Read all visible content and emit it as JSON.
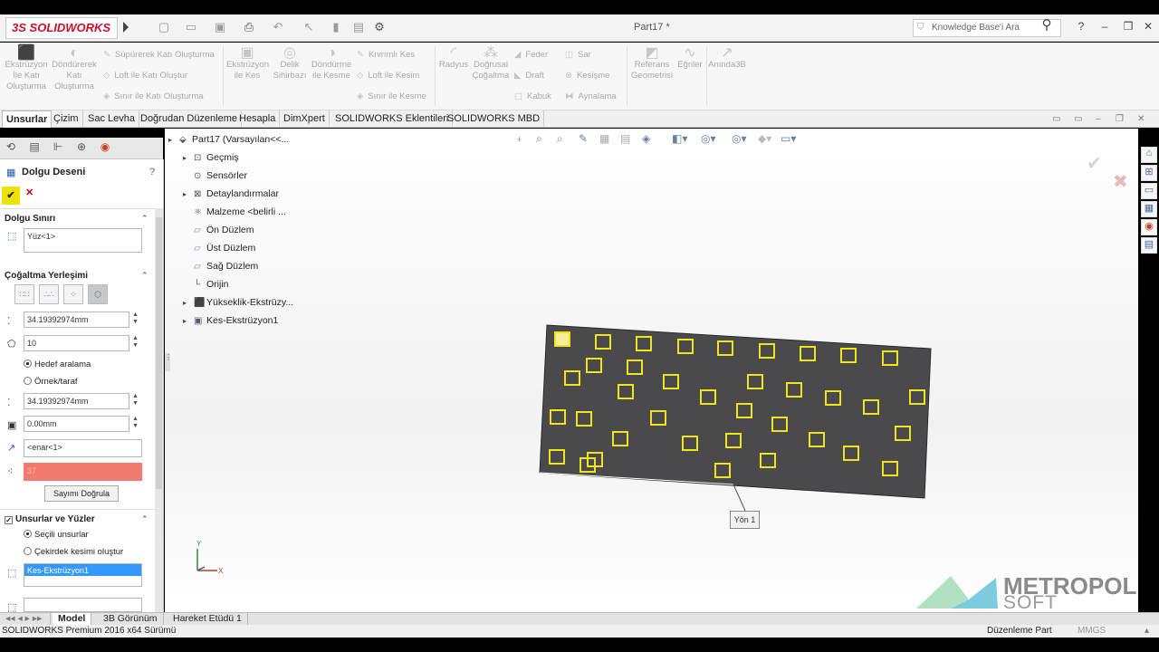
{
  "app": {
    "brand_ds": "3S",
    "brand": "SOLIDWORKS",
    "document_title": "Part17 *"
  },
  "search": {
    "placeholder": "Knowledge Base'i Ara"
  },
  "ribbon": {
    "extrude_boss": "Ekstrüzyon İle Katı Oluşturma",
    "revolve_boss": "Döndürerek Katı Oluşturma",
    "swept_boss": "Süpürerek Katı Oluşturma",
    "loft_boss": "Loft ile Katı Oluştur",
    "boundary_boss": "Sınır ile Katı Oluşturma",
    "extrude_cut": "Ekstrüzyon ile Kes",
    "hole_wizard": "Delik Sihirbazı",
    "revolve_cut": "Döndürme ile Kesme",
    "swept_cut": "Kıvrımlı Kes",
    "loft_cut": "Loft ile Kesim",
    "boundary_cut": "Sınır ile Kesme",
    "fillet": "Radyus",
    "linear_pattern": "Doğrusal Çoğaltma",
    "rib": "Feder",
    "draft": "Draft",
    "shell": "Kabuk",
    "wrap": "Sar",
    "intersect": "Kesişme",
    "mirror": "Aynalama",
    "ref_geometry": "Referans Geometrisi",
    "curves": "Eğriler",
    "instant3d": "Anında3B"
  },
  "tabs": [
    "Unsurlar",
    "Çizim",
    "Sac Levha",
    "Doğrudan Düzenleme",
    "Hesapla",
    "DimXpert",
    "SOLIDWORKS Eklentileri",
    "SOLIDWORKS MBD"
  ],
  "property_manager": {
    "title": "Dolgu Deseni",
    "help": "?",
    "ok": "✔",
    "cancel": "✕",
    "fill_boundary": {
      "label": "Dolgu Sınırı",
      "value": "Yüz<1>"
    },
    "layout": {
      "label": "Çoğaltma Yerleşimi",
      "spacing": "34.19392974mm",
      "count": "10",
      "opt_target": "Hedef aralama",
      "opt_per_side": "Örnek/taraf",
      "spacing2": "34.19392974mm",
      "margin": "0.00mm",
      "direction": "<enar<1>",
      "instance_count": "37",
      "verify_button": "Sayımı Doğrula"
    },
    "features": {
      "label": "Unsurlar ve Yüzler",
      "opt_selected": "Seçili unsurlar",
      "opt_core": "Çekirdek kesimi oluştur",
      "selected_feature": "Kes-Ekstrüzyon1"
    }
  },
  "tree": {
    "root": "Part17  (Varsayılan<<...",
    "items": [
      "Geçmiş",
      "Sensörler",
      "Detaylandırmalar",
      "Malzeme <belirli ...",
      "Ön Düzlem",
      "Üst Düzlem",
      "Sağ Düzlem",
      "Orijin",
      "Yükseklik-Ekstrüzy...",
      "Kes-Ekstrüzyon1"
    ]
  },
  "viewport": {
    "callout": "Yön 1",
    "triad_x": "X",
    "triad_y": "Y"
  },
  "bottom_tabs": [
    "Model",
    "3B Görünüm",
    "Hareket Etüdü 1"
  ],
  "status": {
    "version": "SOLIDWORKS Premium 2016 x64 Sürümü",
    "mode": "Düzenleme Part",
    "units": "MMGS"
  },
  "watermark": {
    "line1": "METROPOL",
    "line2": "SOFT"
  },
  "colors": {
    "plate": "#4a4a4c",
    "square": "#f2e31a",
    "selection": "#3399ff",
    "warn_field": "#f37a6e",
    "brand": "#c8102e"
  }
}
